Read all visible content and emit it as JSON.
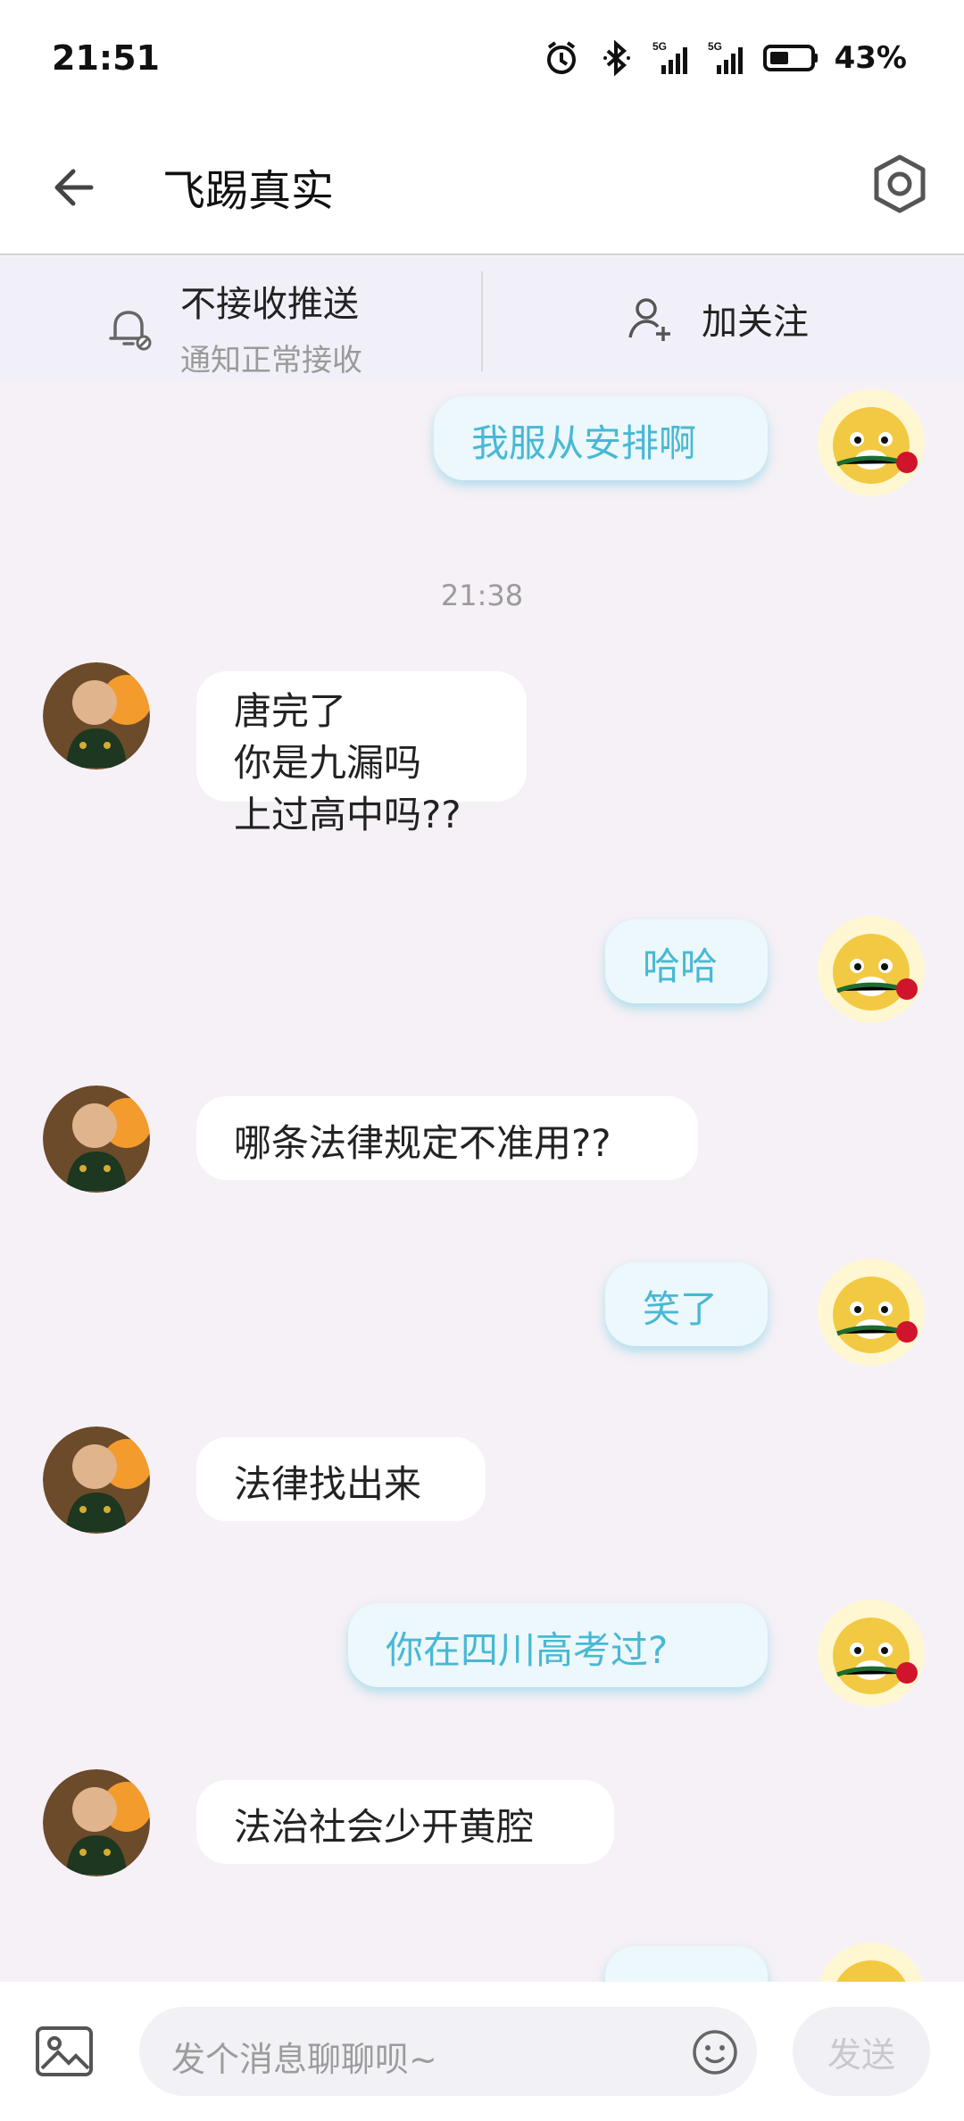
{
  "status": {
    "time": "21:51",
    "battery": "43%",
    "icons": [
      "alarm-icon",
      "bluetooth-icon",
      "5g-signal-icon",
      "5g-signal-icon-2",
      "battery-icon"
    ]
  },
  "header": {
    "title": "飞踢真实",
    "back_icon": "arrow-left-icon",
    "settings_icon": "hex-settings-icon"
  },
  "notice": {
    "push_title": "不接收推送",
    "push_sub": "通知正常接收",
    "follow_label": "加关注"
  },
  "messages": [
    {
      "side": "out",
      "text": "我服从安排啊"
    },
    {
      "timestamp": "21:38"
    },
    {
      "side": "in",
      "text": "唐完了\n你是九漏吗\n上过高中吗??"
    },
    {
      "side": "out",
      "text": "哈哈"
    },
    {
      "side": "in",
      "text": "哪条法律规定不准用??"
    },
    {
      "side": "out",
      "text": "笑了"
    },
    {
      "side": "in",
      "text": "法律找出来"
    },
    {
      "side": "out",
      "text": "你在四川高考过?"
    },
    {
      "side": "in",
      "text": "法治社会少开黄腔"
    }
  ],
  "composer": {
    "placeholder": "发个消息聊聊呗~",
    "send_label": "发送"
  }
}
